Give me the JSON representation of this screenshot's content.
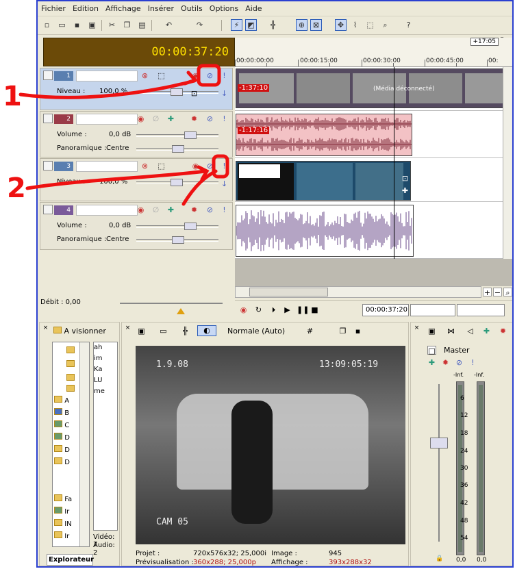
{
  "menu": [
    "Fichier",
    "Edition",
    "Affichage",
    "Insérer",
    "Outils",
    "Options",
    "Aide"
  ],
  "timecode": "00:00:37:20",
  "ruler": {
    "labels": [
      "00:00:00:00",
      "00:00:15:00",
      "00:00:30:00",
      "00:00:45:00",
      "00:"
    ],
    "end_marker": "+17:05"
  },
  "tracks": [
    {
      "num": "1",
      "type": "video",
      "level_label": "Niveau :",
      "level_value": "100,0 %",
      "clip_offset": "-1:37:10",
      "clip_text": "(Média déconnecté)"
    },
    {
      "num": "2",
      "type": "audio",
      "volume_label": "Volume :",
      "volume_value": "0,0 dB",
      "pan_label": "Panoramique :",
      "pan_value": "Centre",
      "clip_offset": "-1:17:16"
    },
    {
      "num": "3",
      "type": "video",
      "level_label": "Niveau :",
      "level_value": "100,0 %"
    },
    {
      "num": "4",
      "type": "audio",
      "volume_label": "Volume :",
      "volume_value": "0,0 dB",
      "pan_label": "Panoramique :",
      "pan_value": "Centre"
    }
  ],
  "debit": "Débit : 0,00",
  "transport_time": "00:00:37:20",
  "explorer": {
    "path": "A visionner",
    "tree_labels": [
      "A",
      "B",
      "C",
      "D",
      "D",
      "D",
      "Fa",
      "Ir",
      "IN",
      "Ir"
    ],
    "files": [
      "ah",
      "im",
      "Ka",
      "LU",
      "me"
    ],
    "info": [
      "Vidéo: 7",
      "Audio: 2"
    ],
    "tab": "Explorateur"
  },
  "preview": {
    "quality": "Normale (Auto)",
    "overlay_date": "1.9.08",
    "overlay_time": "13:09:05:19",
    "overlay_cam": "CAM 05",
    "projet_label": "Projet :",
    "projet_value": "720x576x32; 25,000i",
    "previs_label": "Prévisualisation :",
    "previs_value": "360x288; 25,000p",
    "image_label": "Image :",
    "image_value": "945",
    "affichage_label": "Affichage :",
    "affichage_value": "393x288x32"
  },
  "mixer": {
    "master": "Master",
    "inf_left": "-Inf.",
    "inf_right": "-Inf.",
    "scale": [
      "6",
      "12",
      "18",
      "24",
      "30",
      "36",
      "42",
      "48",
      "54"
    ],
    "val_left": "0,0",
    "val_right": "0,0"
  },
  "annotations": {
    "one": "1",
    "two": "2"
  },
  "colors": {
    "timecode_bg": "#6b4a08",
    "timecode_fg": "#ffe000",
    "track_audio": "#9a3b48",
    "track_video": "#5a7fb0",
    "annot": "#ee1111"
  }
}
